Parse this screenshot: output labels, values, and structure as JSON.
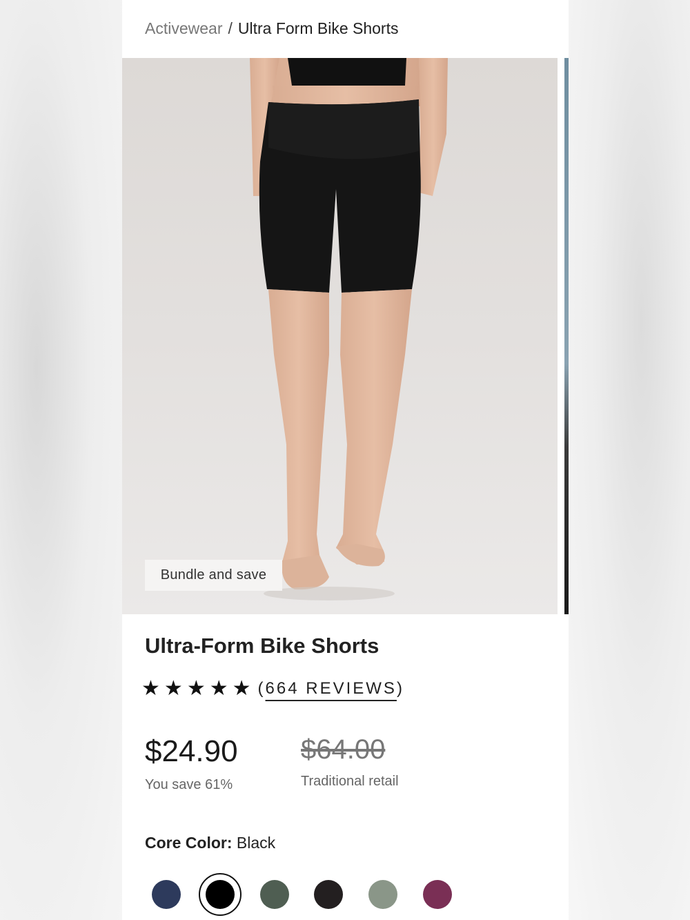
{
  "breadcrumb": {
    "parent": "Activewear",
    "separator": "/",
    "current": "Ultra Form Bike Shorts"
  },
  "gallery": {
    "image_icon": "product-photo-woman-black-bike-shorts",
    "badge": "Bundle and save"
  },
  "product": {
    "title": "Ultra-Form Bike Shorts",
    "rating": {
      "stars": 5,
      "star_icon": "star-icon",
      "paren_open": "(",
      "reviews": "664 REVIEWS",
      "paren_close": ")"
    },
    "price": {
      "current": "$24.90",
      "savings": "You save 61%",
      "original": "$64.00",
      "original_label": "Traditional retail"
    },
    "color": {
      "label": "Core Color:",
      "value": "Black",
      "swatches": [
        {
          "name": "navy",
          "hex": "#2d3a5c"
        },
        {
          "name": "black",
          "hex": "#000000",
          "selected": true
        },
        {
          "name": "forest-green",
          "hex": "#4f5e52"
        },
        {
          "name": "charcoal-black",
          "hex": "#231f20"
        },
        {
          "name": "sage",
          "hex": "#8a9688"
        },
        {
          "name": "berry",
          "hex": "#7a2f55"
        }
      ]
    }
  }
}
